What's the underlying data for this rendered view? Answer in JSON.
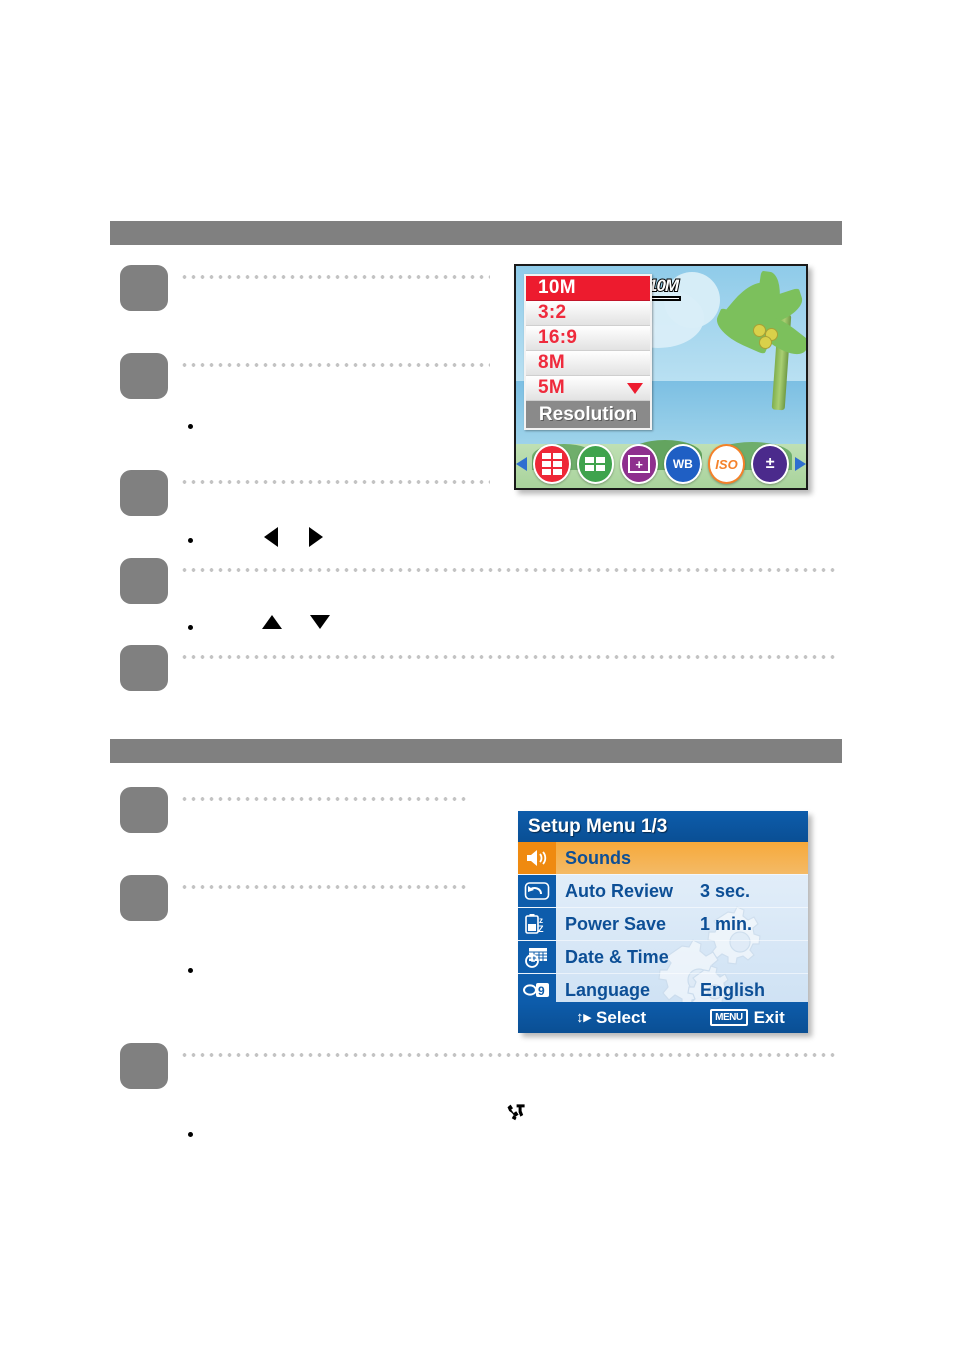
{
  "document": {
    "type": "camera-user-manual-page",
    "sections": [
      {
        "id": "section-1",
        "bar_label": ""
      },
      {
        "id": "section-2",
        "bar_label": ""
      }
    ]
  },
  "steps_section_1": [
    {
      "number": "",
      "text": ""
    },
    {
      "number": "",
      "text": ""
    },
    {
      "number": "",
      "text": ""
    },
    {
      "number": "",
      "text": ""
    },
    {
      "number": "",
      "text": ""
    }
  ],
  "steps_section_2": [
    {
      "number": "",
      "text": ""
    },
    {
      "number": "",
      "text": ""
    },
    {
      "number": "",
      "text": ""
    }
  ],
  "glyphs": {
    "left_arrow": "◀",
    "right_arrow": "▶",
    "up_arrow": "▲",
    "down_arrow": "▼",
    "tools": "tools-wrench-hammer"
  },
  "lcd_resolution_screen": {
    "badge": "10M",
    "menu_title": "Resolution",
    "options": [
      {
        "label": "10M",
        "selected": true
      },
      {
        "label": "3:2",
        "selected": false
      },
      {
        "label": "16:9",
        "selected": false
      },
      {
        "label": "8M",
        "selected": false
      },
      {
        "label": "5M",
        "selected": false
      }
    ],
    "scroll_indicator": "▼",
    "icon_strip": [
      {
        "name": "resolution-icon",
        "label": "",
        "color": "#ee2737"
      },
      {
        "name": "quality-icon",
        "label": "",
        "color": "#3fa34d"
      },
      {
        "name": "sharpness-icon",
        "label": "",
        "color": "#8e2f8e"
      },
      {
        "name": "white-balance-icon",
        "label": "WB",
        "color": "#1f5fc4"
      },
      {
        "name": "iso-icon",
        "label": "ISO",
        "color": "#f4812a"
      },
      {
        "name": "exposure-compensation-icon",
        "label": "",
        "color": "#4b2a8c"
      }
    ],
    "strip_left_arrow": "◀",
    "strip_right_arrow": "▶",
    "colors": {
      "selected_row": "#ed1b2e",
      "option_text": "#ef2a3c",
      "title_bar": "#8a8a8a"
    }
  },
  "lcd_setup_screen": {
    "title": "Setup Menu 1/3",
    "rows": [
      {
        "icon": "sounds-speaker-icon",
        "label": "Sounds",
        "value": "",
        "active": true
      },
      {
        "icon": "auto-review-undo-icon",
        "label": "Auto Review",
        "value": "3 sec.",
        "active": false
      },
      {
        "icon": "power-save-battery-icon",
        "label": "Power Save",
        "value": "1 min.",
        "active": false
      },
      {
        "icon": "date-time-calendar-clock-icon",
        "label": "Date & Time",
        "value": "",
        "active": false
      },
      {
        "icon": "language-icon",
        "label": "Language",
        "value": "English",
        "active": false
      }
    ],
    "footer": {
      "select_label": "Select",
      "select_glyph": "↕▸",
      "exit_key": "MENU",
      "exit_label": "Exit"
    },
    "colors": {
      "title_bar": "#0d5cab",
      "active_row": "#f6a93b",
      "text": "#0d4f96",
      "body": "#e6f0fa"
    }
  }
}
